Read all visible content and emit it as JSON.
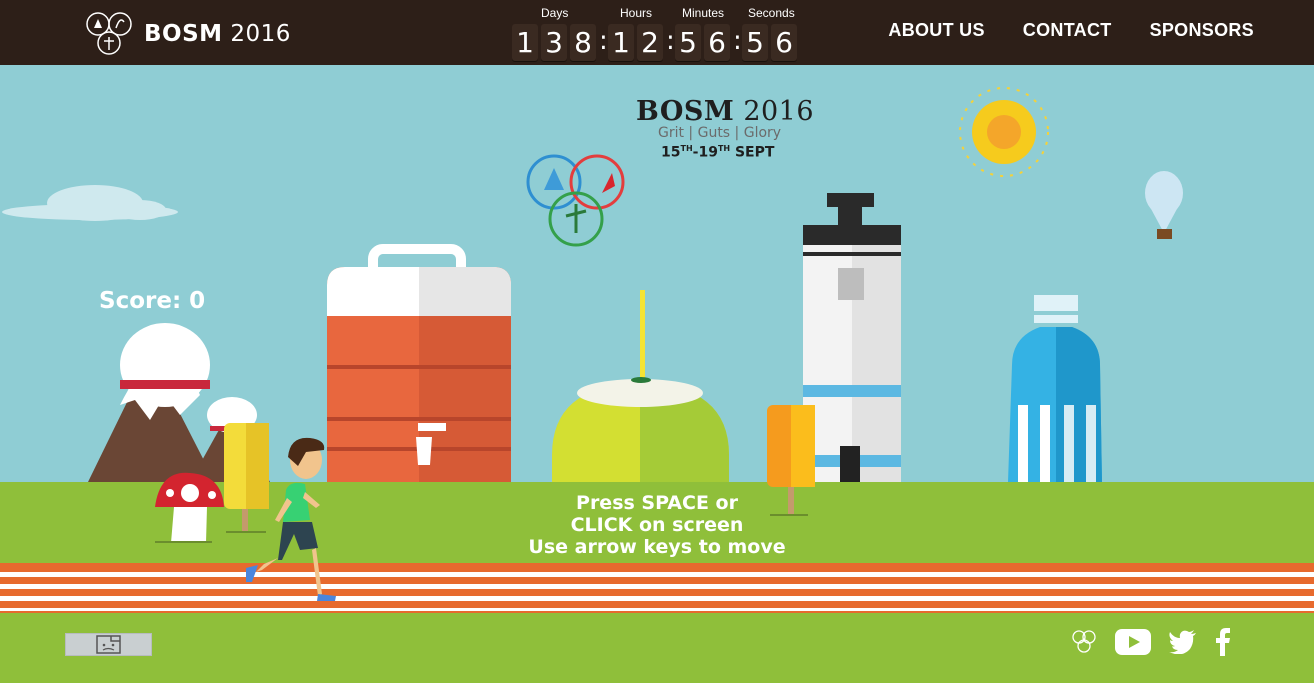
{
  "header": {
    "brand_bold": "BOSM",
    "brand_year": "2016",
    "countdown": {
      "labels": {
        "days": "Days",
        "hours": "Hours",
        "minutes": "Minutes",
        "seconds": "Seconds"
      },
      "digits": [
        "1",
        "3",
        "8",
        "1",
        "2",
        "5",
        "6",
        "5",
        "6"
      ],
      "separator": ":"
    },
    "nav": [
      {
        "label": "ABOUT US"
      },
      {
        "label": "CONTACT"
      },
      {
        "label": "SPONSORS"
      }
    ]
  },
  "main_logo": {
    "title_bold": "BOSM",
    "title_year": "2016",
    "tagline": "Grit | Guts | Glory",
    "date_day1": "15",
    "date_sup1": "TH",
    "date_sep": "-",
    "date_day2": "19",
    "date_sup2": "TH",
    "date_month": "SEPT"
  },
  "game": {
    "score_text": "Score: 0",
    "instructions": [
      "Press SPACE or",
      "CLICK on screen",
      "Use arrow keys to move"
    ]
  },
  "footer": {
    "social_icons": [
      "bosm-logo-icon",
      "youtube-icon",
      "twitter-icon",
      "facebook-icon"
    ]
  },
  "colors": {
    "topbar": "#2d1f18",
    "sky": "#8fcdd4",
    "grass": "#8fbf3a",
    "track": "#e76a2e"
  }
}
